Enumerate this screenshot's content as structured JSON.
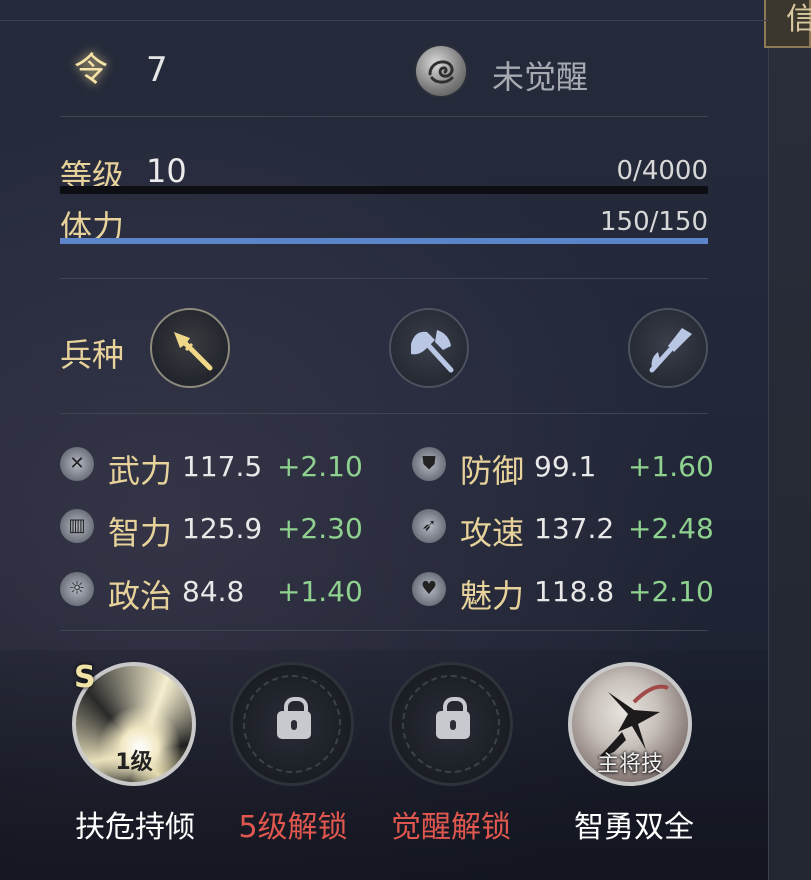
{
  "corner_tab": "信",
  "header": {
    "order_icon": "令",
    "order_value": "7",
    "awaken_icon": "dragon-emblem-icon",
    "awaken_status": "未觉醒"
  },
  "level": {
    "label": "等级",
    "value": "10",
    "exp": "0/4000",
    "exp_progress": 0.0
  },
  "stamina": {
    "label": "体力",
    "value": "150/150",
    "progress": 1.0
  },
  "troops": {
    "label": "兵种",
    "items": [
      {
        "icon": "spear-icon",
        "active": true
      },
      {
        "icon": "axe-icon",
        "active": false
      },
      {
        "icon": "halberd-icon",
        "active": false
      }
    ]
  },
  "stats": [
    {
      "icon": "crossed-swords-icon",
      "name": "武力",
      "value": "117.5",
      "bonus": "+2.10"
    },
    {
      "icon": "shield-icon",
      "name": "防御",
      "value": "99.1",
      "bonus": "+1.60"
    },
    {
      "icon": "scroll-icon",
      "name": "智力",
      "value": "125.9",
      "bonus": "+2.30"
    },
    {
      "icon": "boot-icon",
      "name": "攻速",
      "value": "137.2",
      "bonus": "+2.48"
    },
    {
      "icon": "sun-emblem-icon",
      "name": "政治",
      "value": "84.8",
      "bonus": "+1.40"
    },
    {
      "icon": "heart-icon",
      "name": "魅力",
      "value": "118.8",
      "bonus": "+2.10"
    }
  ],
  "skills": [
    {
      "grade": "S",
      "badge": "1级",
      "name": "扶危持倾",
      "state": "unlocked"
    },
    {
      "name": "5级解锁",
      "state": "locked",
      "icon": "lock-icon"
    },
    {
      "name": "觉醒解锁",
      "state": "locked",
      "icon": "lock-icon"
    },
    {
      "badge": "主将技",
      "name": "智勇双全",
      "state": "unlocked"
    }
  ],
  "colors": {
    "gold": "#e6d29a",
    "bonus_green": "#8fd18f",
    "locked_red": "#e0574f",
    "stamina_blue": "#5b85c8"
  }
}
